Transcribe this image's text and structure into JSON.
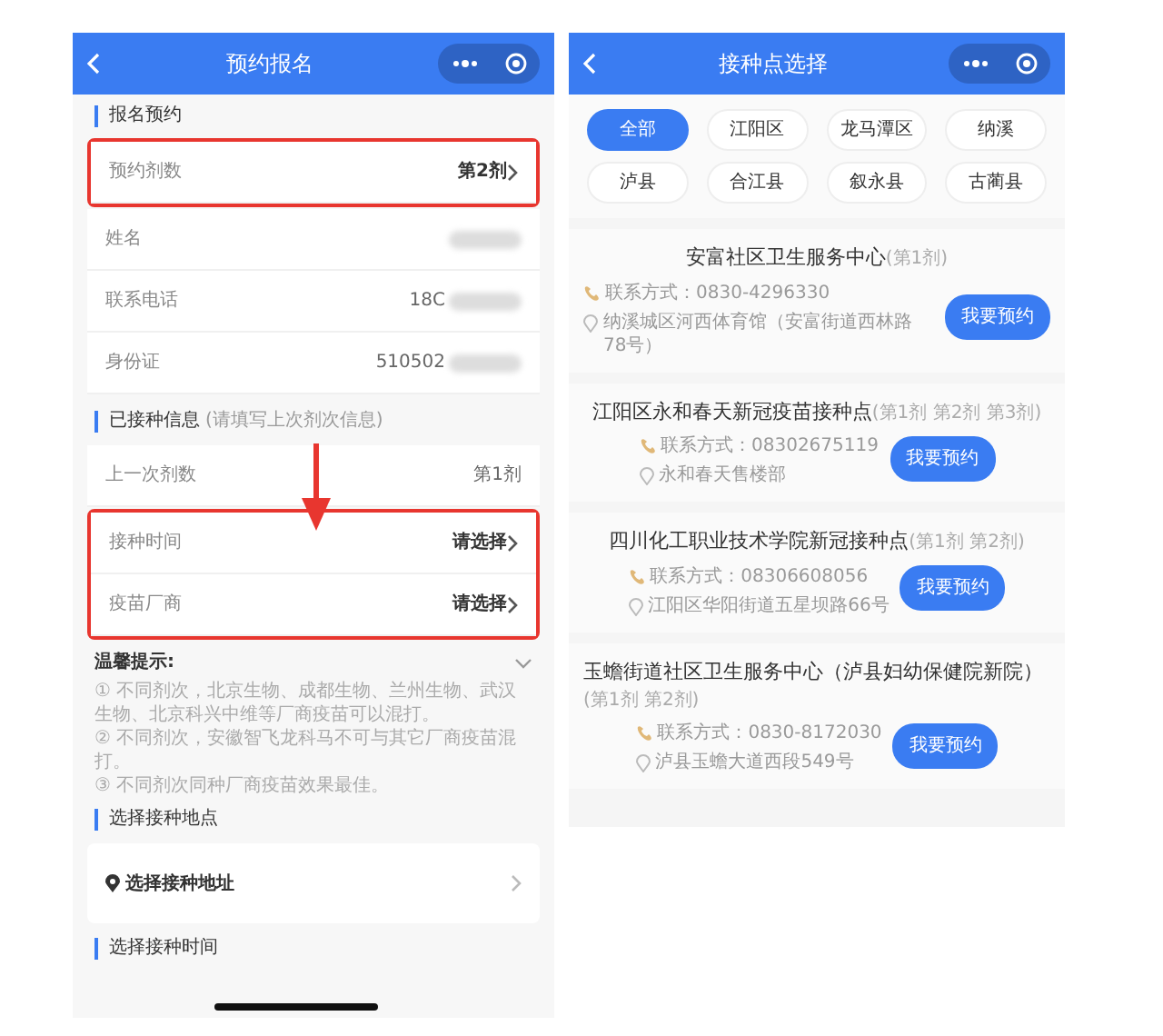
{
  "registration": {
    "title": "预约报名",
    "section_1": {
      "heading": "报名预约",
      "groups": [
        {
          "highlighted": true,
          "rows": [
            {
              "label": "预约剂数",
              "value": "第2剂",
              "chevron": true
            }
          ]
        },
        {
          "rows": [
            {
              "label": "姓名",
              "redacted": true
            },
            {
              "label": "联系电话",
              "value": "18C",
              "redacted": true
            },
            {
              "label": "身份证",
              "value": "510502",
              "redacted": true
            }
          ]
        }
      ]
    },
    "annotation_arrow": true,
    "section_2": {
      "heading": "已接种信息",
      "note": "(请填写上次剂次信息)",
      "groups": [
        {
          "rows": [
            {
              "label": "上一次剂数",
              "value": "第1剂"
            }
          ]
        },
        {
          "highlighted": true,
          "rows": [
            {
              "label": "接种时间",
              "value": "请选择",
              "chevron": true
            },
            {
              "label": "疫苗厂商",
              "value": "请选择",
              "chevron": true
            }
          ]
        }
      ]
    },
    "tips": {
      "heading": "温馨提示:",
      "expanded": true,
      "items": [
        "① 不同剂次，北京生物、成都生物、兰州生物、武汉生物、北京科兴中维等厂商疫苗可以混打。",
        "② 不同剂次，安徽智飞龙科马不可与其它厂商疫苗混打。",
        "③ 不同剂次同种厂商疫苗效果最佳。"
      ]
    },
    "section_3": {
      "heading": "选择接种地点",
      "picker": "选择接种地址"
    },
    "section_4": {
      "heading": "选择接种时间"
    }
  },
  "site_selection": {
    "title": "接种点选择",
    "filters": [
      {
        "label": "全部",
        "selected": true
      },
      {
        "label": "江阳区",
        "selected": false
      },
      {
        "label": "龙马潭区",
        "selected": false
      },
      {
        "label": "纳溪",
        "selected": false
      },
      {
        "label": "泸县",
        "selected": false
      },
      {
        "label": "合江县",
        "selected": false
      },
      {
        "label": "叙永县",
        "selected": false
      },
      {
        "label": "古蔺县",
        "selected": false
      }
    ],
    "sites": [
      {
        "name": "安富社区卫生服务中心",
        "doses": "(第1剂)",
        "phone": "联系方式：0830-4296330",
        "address": "纳溪城区河西体育馆（安富街道西林路78号）",
        "button": "我要预约"
      },
      {
        "name": "江阳区永和春天新冠疫苗接种点",
        "doses": "(第1剂 第2剂 第3剂)",
        "phone": "联系方式：08302675119",
        "address": "永和春天售楼部",
        "button": "我要预约"
      },
      {
        "name": "四川化工职业技术学院新冠接种点",
        "doses": "(第1剂 第2剂)",
        "phone": "联系方式：08306608056",
        "address": "江阳区华阳街道五星坝路66号",
        "button": "我要预约"
      },
      {
        "name": "玉蟾街道社区卫生服务中心（泸县妇幼保健院新院）",
        "doses": "(第1剂 第2剂)",
        "phone": "联系方式：0830-8172030",
        "address": "泸县玉蟾大道西段549号",
        "button": "我要预约"
      }
    ]
  }
}
